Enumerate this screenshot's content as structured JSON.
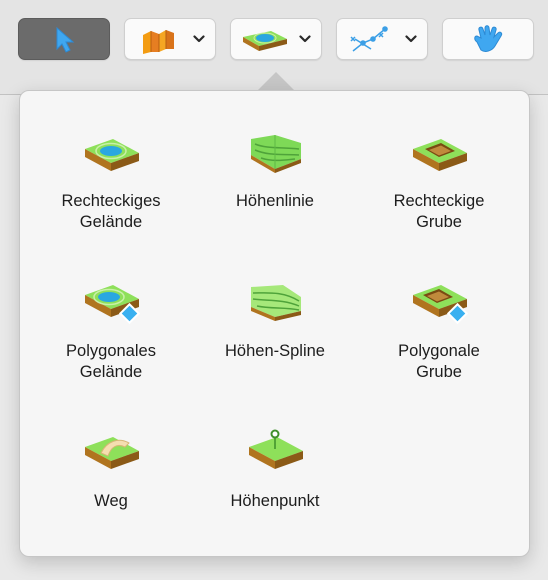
{
  "toolbar": {
    "buttons": [
      {
        "icon": "pointer-arrow-icon",
        "active": true
      },
      {
        "icon": "wall-tool-icon",
        "has_menu": true
      },
      {
        "icon": "terrain-tool-icon",
        "has_menu": true
      },
      {
        "icon": "path-nodes-icon",
        "has_menu": true
      },
      {
        "icon": "hand-icon"
      }
    ]
  },
  "popover": {
    "items": [
      {
        "label": "Rechteckiges\nGelände",
        "icon": "rectangular-terrain-icon"
      },
      {
        "label": "Höhenlinie",
        "icon": "contour-line-icon"
      },
      {
        "label": "Rechteckige\nGrube",
        "icon": "rectangular-pit-icon"
      },
      {
        "label": "Polygonales\nGelände",
        "icon": "polygonal-terrain-icon"
      },
      {
        "label": "Höhen-Spline",
        "icon": "height-spline-icon"
      },
      {
        "label": "Polygonale\nGrube",
        "icon": "polygonal-pit-icon"
      },
      {
        "label": "Weg",
        "icon": "path-icon"
      },
      {
        "label": "Höhenpunkt",
        "icon": "height-point-icon"
      }
    ]
  },
  "colors": {
    "active_button": "#6b6b6b",
    "grass_green": "#7ed957",
    "soil_brown": "#b0741f",
    "water_blue": "#2aa7e0",
    "accent_blue": "#3b9fe6"
  }
}
